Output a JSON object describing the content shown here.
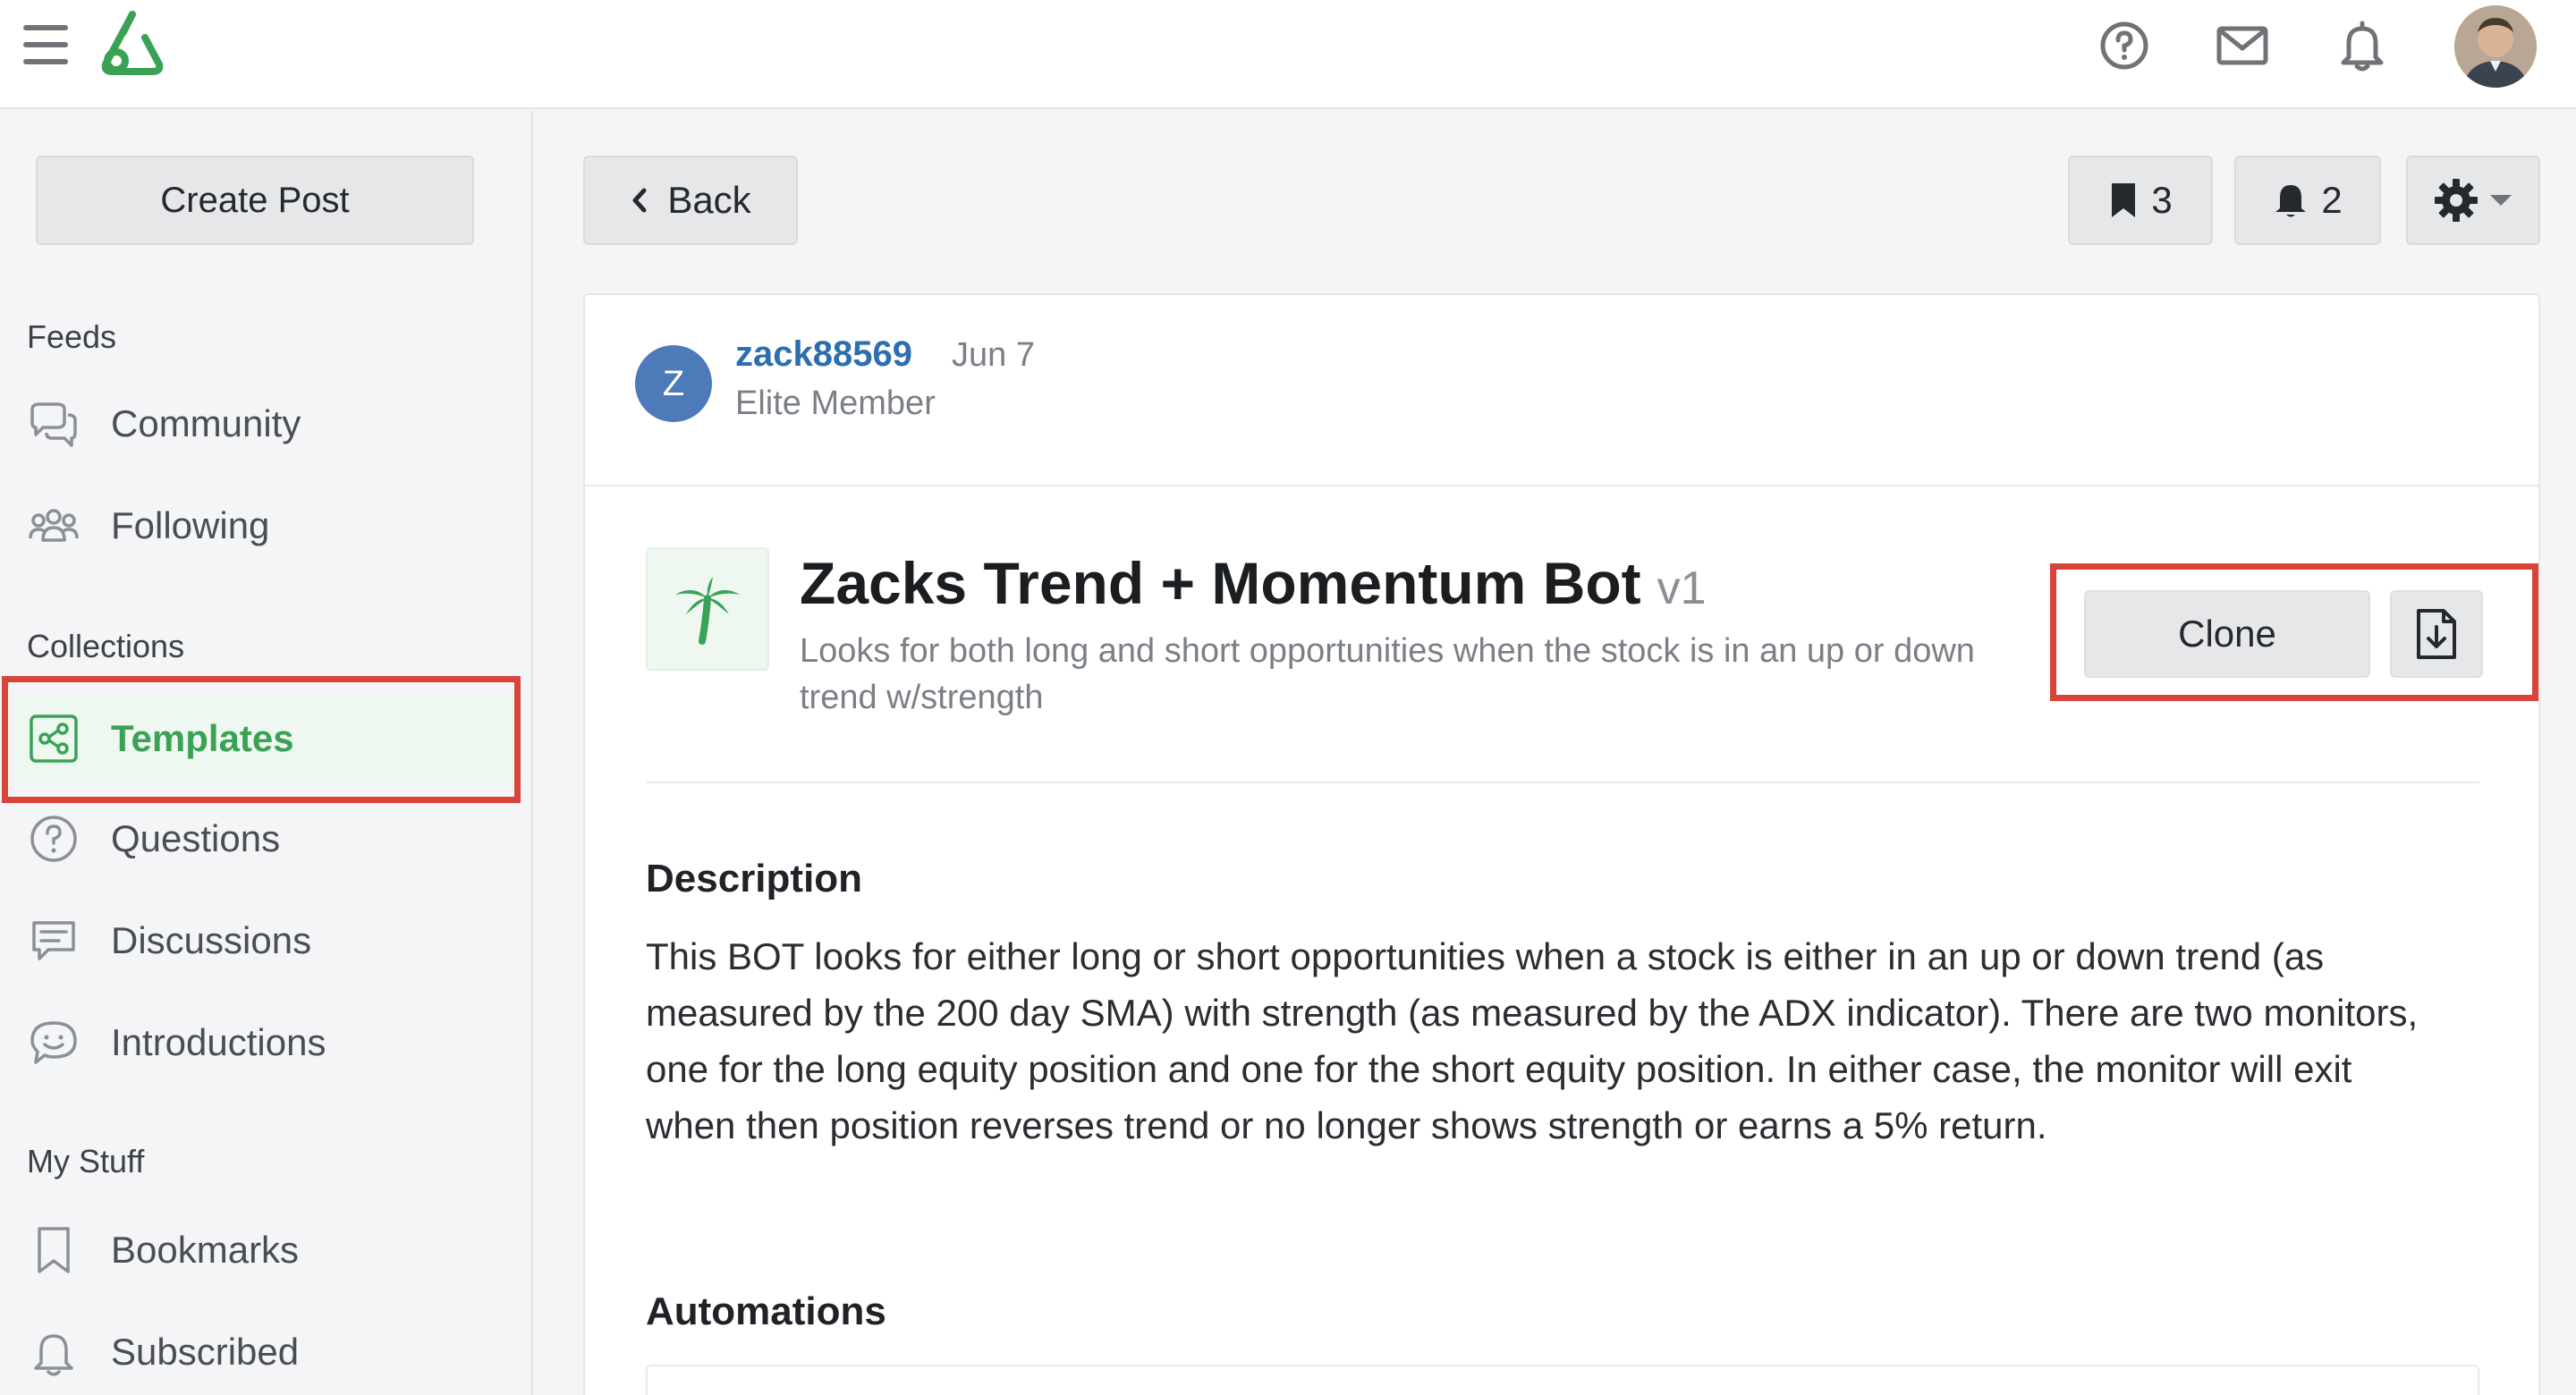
{
  "topbar": {
    "icons": [
      "hamburger-icon",
      "logo",
      "help-icon",
      "mail-icon",
      "bell-icon",
      "avatar"
    ]
  },
  "sidebar": {
    "create_post": "Create Post",
    "feeds_label": "Feeds",
    "feeds": [
      {
        "label": "Community",
        "icon": "chat-bubbles-icon"
      },
      {
        "label": "Following",
        "icon": "people-icon"
      }
    ],
    "collections_label": "Collections",
    "collections": [
      {
        "label": "Templates",
        "icon": "share-icon",
        "active": true
      },
      {
        "label": "Questions",
        "icon": "question-circle-icon"
      },
      {
        "label": "Discussions",
        "icon": "comment-icon"
      },
      {
        "label": "Introductions",
        "icon": "smile-bubble-icon"
      }
    ],
    "mystuff_label": "My Stuff",
    "mystuff": [
      {
        "label": "Bookmarks",
        "icon": "bookmark-icon"
      },
      {
        "label": "Subscribed",
        "icon": "bell-icon"
      }
    ]
  },
  "toolbar": {
    "back": "Back",
    "bookmark_count": "3",
    "subscribe_count": "2"
  },
  "post": {
    "author_initial": "Z",
    "author": "zack88569",
    "date": "Jun 7",
    "role": "Elite Member",
    "title": "Zacks Trend + Momentum Bot",
    "version": "v1",
    "subtitle": "Looks for both long and short opportunities when the stock is in an up or down trend w/strength",
    "clone_label": "Clone",
    "description_heading": "Description",
    "description": "This BOT looks for either long or short opportunities when a stock is either in an up or down trend (as measured by the 200 day SMA) with strength (as measured by the ADX indicator). There are two monitors, one for the long equity position and one for the short equity position. In either case, the monitor will exit when then position reverses trend or no longer shows strength or earns a 5% return.",
    "automations_heading": "Automations"
  },
  "colors": {
    "accent_green": "#3aa255",
    "link_blue": "#2d6eb0",
    "highlight_red": "#d9443a"
  }
}
